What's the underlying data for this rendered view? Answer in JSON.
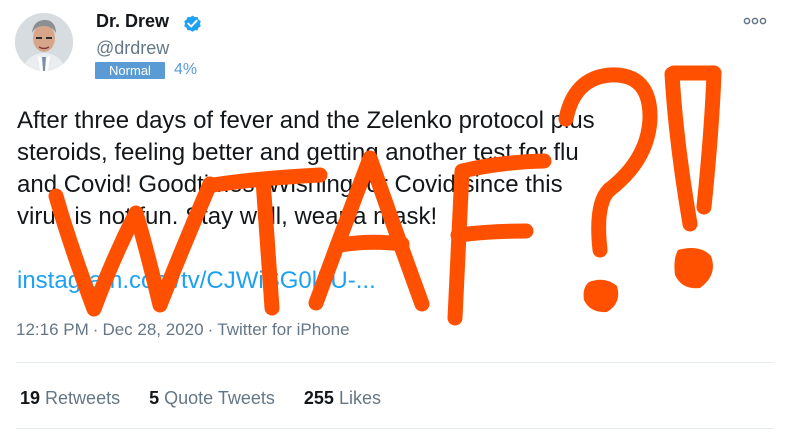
{
  "tweet": {
    "display_name": "Dr. Drew",
    "handle": "@drdrew",
    "badge": "Normal",
    "badge_percent": "4%",
    "text_lines": [
      "After three days of fever and the Zelenko protocol plus",
      "steroids, feeling better and getting another test for flu",
      "and Covid! Goodtimes. Wishing for Covid since this",
      "virus is not fun. Stay well, wear a mask!"
    ],
    "link": "instagram.com/tv/CJWiSG0lLU-...",
    "time": "12:16 PM",
    "date": "Dec 28, 2020",
    "source": "Twitter for iPhone",
    "retweets_count": "19",
    "retweets_label": "Retweets",
    "quote_tweets_count": "5",
    "quote_tweets_label": "Quote Tweets",
    "likes_count": "255",
    "likes_label": "Likes"
  },
  "overlay": {
    "text": "WTAF?!",
    "color": "#ff5000"
  },
  "icons": {
    "verified": "verified-badge-icon",
    "more": "more-options-icon",
    "avatar": "profile-photo"
  },
  "colors": {
    "verified_blue": "#1da1f2",
    "link_blue": "#1da1f2",
    "badge_blue": "#5b9bd5",
    "muted_gray": "#657786",
    "overlay_orange": "#ff5000"
  }
}
